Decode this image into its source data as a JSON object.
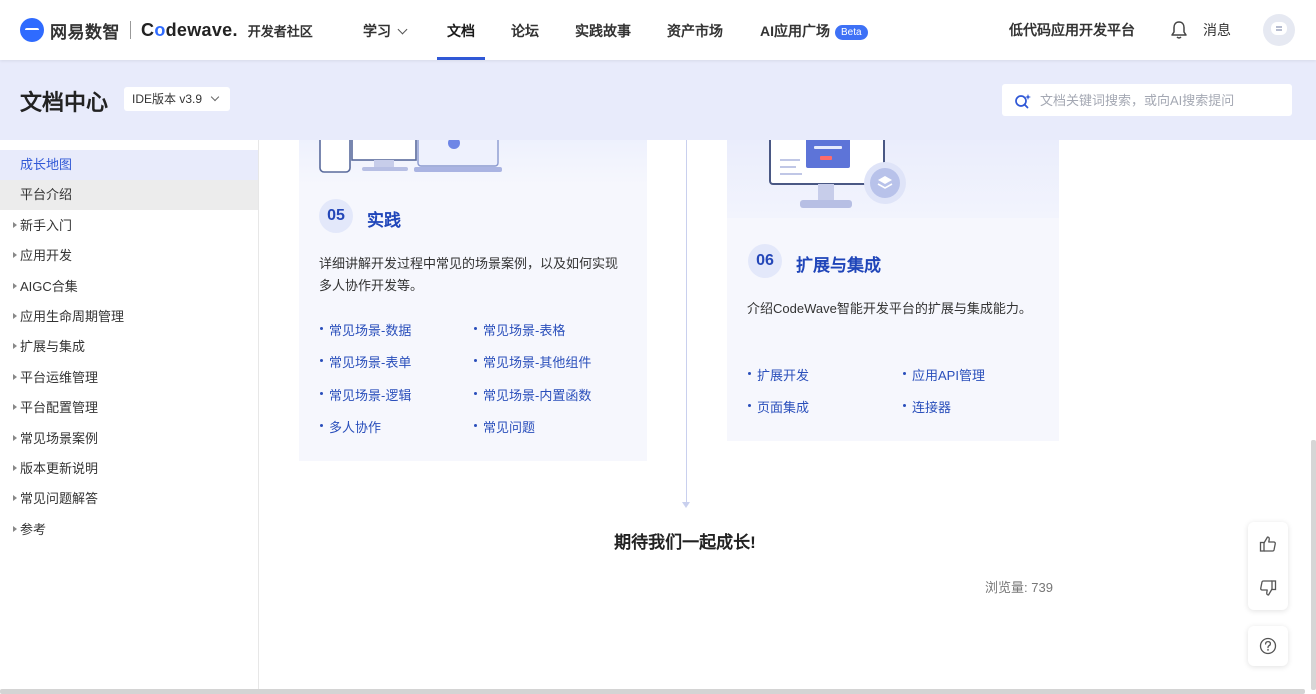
{
  "brand": {
    "company": "网易数智",
    "product_prefix": "C",
    "product_o": "o",
    "product_suffix": "dewave.",
    "community": "开发者社区"
  },
  "nav": {
    "items": [
      "学习",
      "文档",
      "论坛",
      "实践故事",
      "资产市场",
      "AI应用广场"
    ],
    "active": "文档",
    "beta_badge": "Beta",
    "platform_link": "低代码应用开发平台",
    "messages": "消息"
  },
  "subheader": {
    "title": "文档中心",
    "version": "IDE版本 v3.9",
    "search_placeholder": "文档关键词搜索，或向AI搜索提问"
  },
  "sidebar": {
    "items": [
      {
        "label": "成长地图",
        "state": "selected"
      },
      {
        "label": "平台介绍",
        "state": "hover"
      },
      {
        "label": "新手入门",
        "state": "collapsed"
      },
      {
        "label": "应用开发",
        "state": "collapsed"
      },
      {
        "label": "AIGC合集",
        "state": "collapsed"
      },
      {
        "label": "应用生命周期管理",
        "state": "collapsed"
      },
      {
        "label": "扩展与集成",
        "state": "collapsed"
      },
      {
        "label": "平台运维管理",
        "state": "collapsed"
      },
      {
        "label": "平台配置管理",
        "state": "collapsed"
      },
      {
        "label": "常见场景案例",
        "state": "collapsed"
      },
      {
        "label": "版本更新说明",
        "state": "collapsed"
      },
      {
        "label": "常见问题解答",
        "state": "collapsed"
      },
      {
        "label": "参考",
        "state": "collapsed"
      }
    ]
  },
  "cards": [
    {
      "number": "05",
      "title": "实践",
      "description": "详细讲解开发过程中常见的场景案例，以及如何实现多人协作开发等。",
      "links": [
        "常见场景-数据",
        "常见场景-表格",
        "常见场景-表单",
        "常见场景-其他组件",
        "常见场景-逻辑",
        "常见场景-内置函数",
        "多人协作",
        "常见问题"
      ]
    },
    {
      "number": "06",
      "title": "扩展与集成",
      "description": "介绍CodeWave智能开发平台的扩展与集成能力。",
      "links": [
        "扩展开发",
        "应用API管理",
        "页面集成",
        "连接器"
      ]
    }
  ],
  "footer": {
    "closing": "期待我们一起成长!",
    "views_label": "浏览量:",
    "views_count": "739"
  },
  "colors": {
    "accent": "#3058d6",
    "subheader_bg": "#e8ebfb",
    "card_bg": "#f6f7fd"
  }
}
